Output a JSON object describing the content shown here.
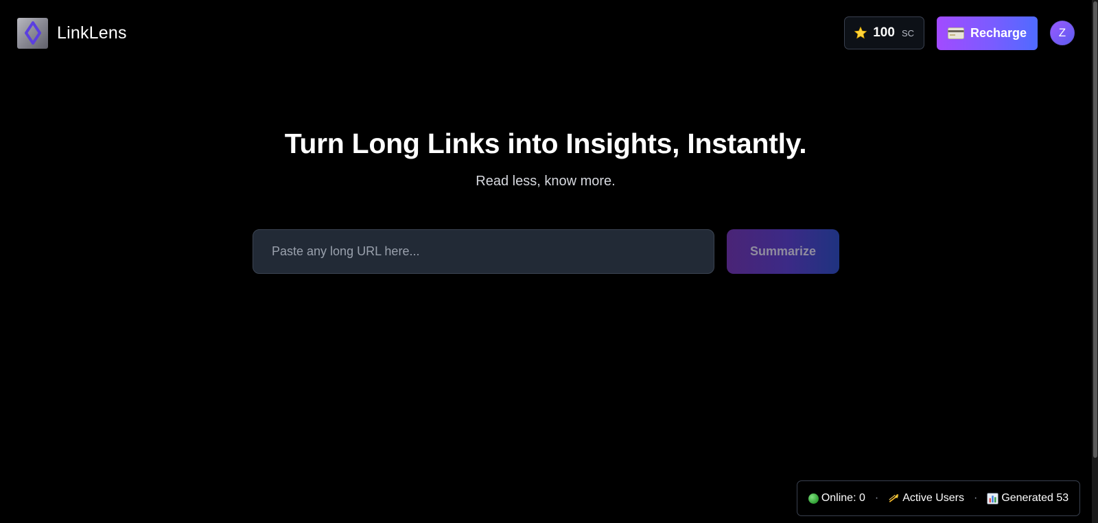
{
  "app": {
    "name": "LinkLens"
  },
  "header": {
    "credits": {
      "value": "100",
      "unit": "SC"
    },
    "recharge_label": "Recharge",
    "avatar_initial": "Z"
  },
  "hero": {
    "title": "Turn Long Links into Insights, Instantly.",
    "subtitle": "Read less, know more."
  },
  "search": {
    "placeholder": "Paste any long URL here...",
    "value": "",
    "submit_label": "Summarize"
  },
  "status": {
    "online": "Online: 0",
    "active": "Active Users",
    "generated": "Generated 53",
    "separator": "·"
  },
  "colors": {
    "background": "#000000",
    "accent_purple": "#a24bff",
    "accent_blue": "#4f6bff",
    "input_bg": "#222a36"
  },
  "icons": {
    "logo": "diamond-logo-icon",
    "credits": "star-icon",
    "recharge": "credit-card-icon",
    "online": "green-dot-icon",
    "active": "dizzy-icon",
    "generated": "bar-chart-icon"
  }
}
